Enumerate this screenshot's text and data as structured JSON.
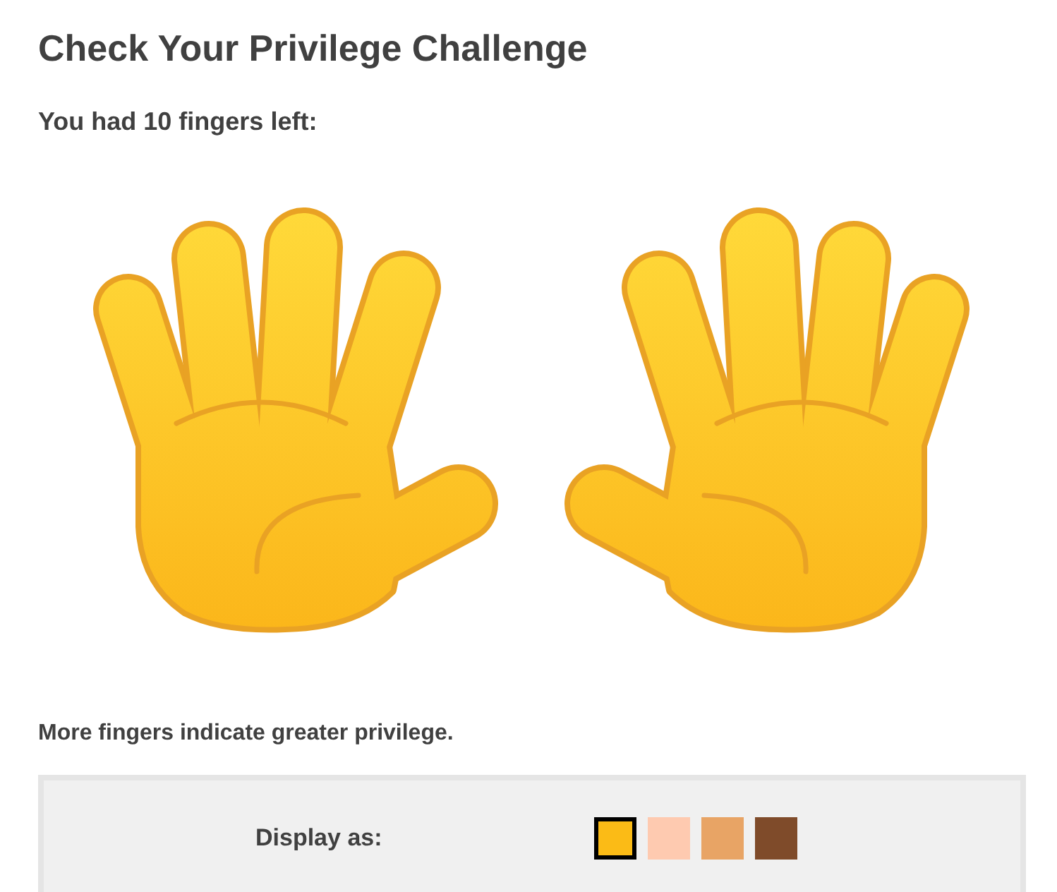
{
  "title": "Check Your Privilege Challenge",
  "subtitle": "You had 10 fingers left:",
  "note": "More fingers indicate greater privilege.",
  "display": {
    "label": "Display as:",
    "swatches": [
      {
        "color": "#fbbb16",
        "selected": true
      },
      {
        "color": "#fecab0",
        "selected": false
      },
      {
        "color": "#e8a465",
        "selected": false
      },
      {
        "color": "#7f4b2a",
        "selected": false
      }
    ]
  }
}
